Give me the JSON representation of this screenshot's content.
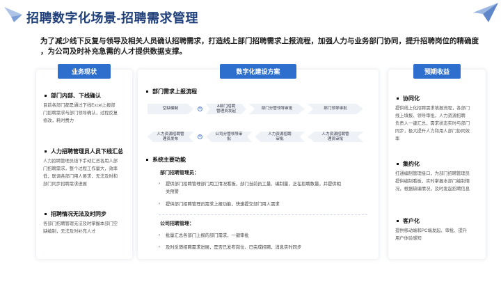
{
  "title": "招聘数字化场景-招聘需求管理",
  "intro": {
    "line1": "为了减少线下反复与领导及相关人员确认招聘需求，打造线上部门招聘需求上报流程，加强人力与业务部门协同，提升招聘岗位的精确度",
    "line2": "，为公司及时补充急需的人才提供数据支撑。"
  },
  "left": {
    "header": "业务现状",
    "sections": [
      {
        "title": "部门内部、下线确认",
        "text": [
          "目前各部门都是通过下线Excel上报部",
          "门招聘需求与部门领导确认，过程反复",
          "修改，耗时费力"
        ]
      },
      {
        "title": "人力招聘管理员人员下线汇总",
        "text": [
          "人力招聘管理员线下手动汇总各用人部",
          "门招聘需求，整个过程工作量大，效率",
          "低，联调各部门用人要求，无法及时和",
          "部门同步招聘需求进展"
        ]
      },
      {
        "title": "招聘情况无法及时同步",
        "text": [
          "各部门招聘管理无法及时掌握本部门空",
          "缺编制，无法及时补充人才"
        ]
      }
    ]
  },
  "mid": {
    "header": "数字化建设方案",
    "sec1": "部门需求上报流程",
    "flow_row1": [
      "空缺编制",
      "A部门招聘\n管理员发起",
      "部门分管领导审批",
      "部门领导审批"
    ],
    "flow_row2": [
      "人力资源招聘管\n理员发布",
      "公司分管领导审\n批",
      "人力资源招聘\n审批",
      "人力资源招聘管\n理员审批"
    ],
    "plus_icon": "⊗",
    "sec2": "系统主要功能",
    "sub1": "部门招聘管理员：",
    "sub1_items": [
      [
        "提供部门招聘管理部门用工情况看板，部门当前员工量、编制量，正在招聘数量，并提供相",
        "关预警"
      ],
      [
        "提供部门招聘管理员需求上报功能，快速提交部门用人需求"
      ]
    ],
    "sub2": "公司招聘管理：",
    "sub2_items": [
      [
        "批量汇总各部门上报的部门需求，一键审批"
      ],
      [
        "及时反馈招聘需求进展，是否已发布岗位、已完成招聘，消息实时同步"
      ]
    ]
  },
  "right": {
    "header": "预期收益",
    "sections": [
      {
        "title": "协同化",
        "text": [
          "提供线上化招聘需求填报流程，各部门",
          "线上填报、领导审批，人力资源招聘",
          "负责人一键汇总，需求状态实时与部门",
          "同步，极大提升人力和用人部门协同效",
          "率"
        ]
      },
      {
        "title": "集约化",
        "text": [
          "打通编制管理接口，为部门招聘管理员",
          "提供编制看板，实时掌握本部门编制情",
          "况，根据缺编情况，及时发起招聘信息"
        ]
      },
      {
        "title": "客户化",
        "text": [
          "提供移动端和PC端发起、审批、提升",
          "用户体验感知"
        ]
      }
    ]
  },
  "colors": {
    "title": "#1f3f7a",
    "header": "#2e6fce",
    "accent": "#6b8ccc"
  },
  "chevron": "›",
  "icons": {
    "top_left": "paper-plane-icon",
    "top_right": "paper-plane-icon"
  }
}
